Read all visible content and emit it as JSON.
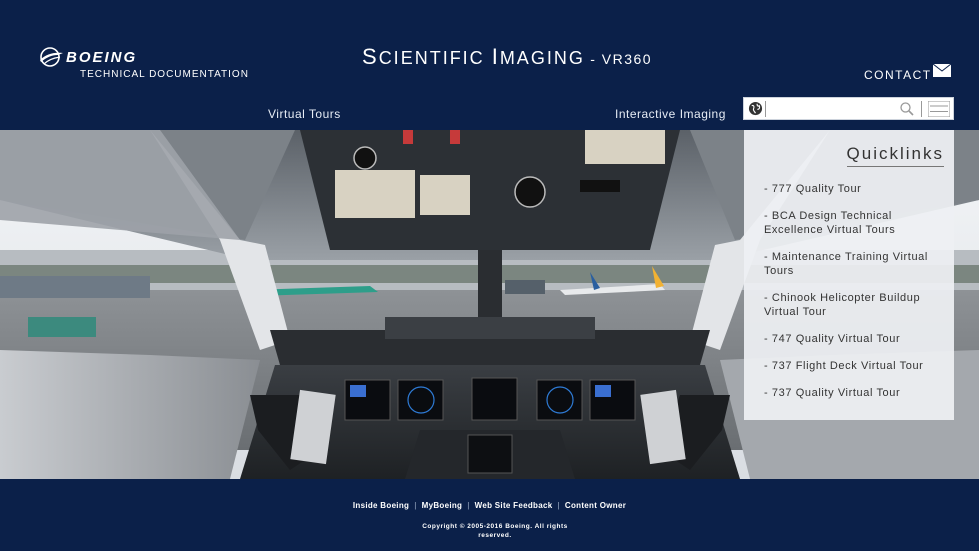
{
  "header": {
    "logo_text": "BOEING",
    "subtitle": "TECHNICAL DOCUMENTATION",
    "site_title_a_cap": "S",
    "site_title_a_rest": "CIENTIFIC ",
    "site_title_b_cap": "I",
    "site_title_b_rest": "MAGING",
    "site_title_suffix": " - VR360",
    "contact_label": "CONTACT"
  },
  "nav": {
    "virtual_tours": "Virtual Tours",
    "interactive_imaging": "Interactive Imaging"
  },
  "search": {
    "value": "",
    "placeholder": ""
  },
  "quicklinks": {
    "title": "Quicklinks",
    "items": [
      "- 777 Quality Tour",
      "- BCA Design Technical Excellence Virtual Tours",
      "- Maintenance Training Virtual Tours",
      "- Chinook Helicopter Buildup Virtual Tour",
      "- 747 Quality Virtual Tour",
      "- 737 Flight Deck Virtual Tour",
      "- 737 Quality Virtual Tour"
    ]
  },
  "footer": {
    "links": [
      "Inside Boeing",
      "MyBoeing",
      "Web Site Feedback",
      "Content Owner"
    ],
    "copyright": "Copyright © 2005-2016 Boeing.  All rights reserved."
  },
  "colors": {
    "navy": "#0b2049",
    "panel": "#eef0f3"
  }
}
